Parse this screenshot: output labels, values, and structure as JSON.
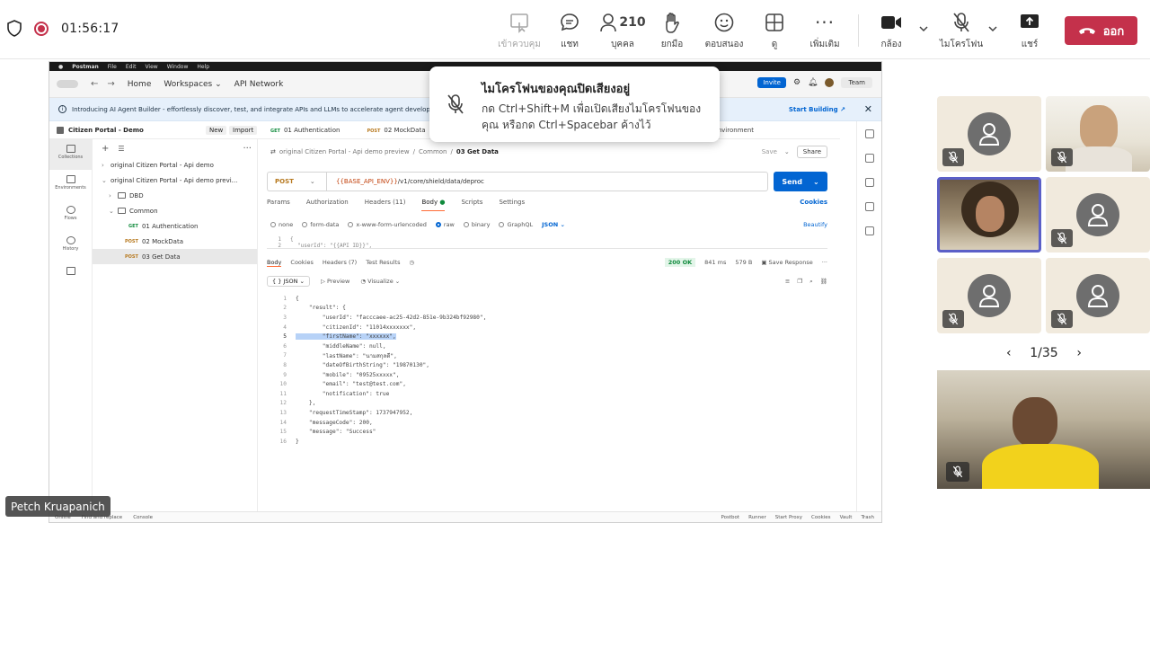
{
  "meeting": {
    "timer": "01:56:17",
    "toolbar": {
      "take_control": "เข้าควบคุม",
      "chat": "แชท",
      "people": "บุคคล",
      "people_count": "210",
      "raise_hand": "ยกมือ",
      "react": "ตอบสนอง",
      "view": "ดู",
      "more": "เพิ่มเติม",
      "camera": "กล้อง",
      "mic": "ไมโครโฟน",
      "share": "แชร์",
      "leave": "ออก"
    },
    "toast": {
      "title": "ไมโครโฟนของคุณปิดเสียงอยู่",
      "body": "กด Ctrl+Shift+M เพื่อเปิดเสียงไมโครโฟนของคุณ หรือกด Ctrl+Spacebar ค้างไว้"
    },
    "gallery": {
      "page": "1/35"
    },
    "presenter_name": "Petch Kruapanich"
  },
  "postman": {
    "menubar": [
      "Postman",
      "File",
      "Edit",
      "View",
      "Window",
      "Help"
    ],
    "header": {
      "home": "Home",
      "workspaces": "Workspaces",
      "api_network": "API Network",
      "invite": "Invite",
      "team": "Team"
    },
    "banner": {
      "text": "Introducing AI Agent Builder - effortlessly discover, test, and integrate APIs and LLMs to accelerate agent developme",
      "cta": "Start Building"
    },
    "workspace": {
      "name": "Citizen Portal - Demo",
      "new": "New",
      "import": "Import"
    },
    "rail": [
      "Collections",
      "Environments",
      "Flows",
      "History"
    ],
    "tree": [
      {
        "label": "original Citizen Portal - Api demo",
        "type": "collection",
        "arrow": "›"
      },
      {
        "label": "original Citizen Portal - Api demo previ...",
        "type": "collection",
        "arrow": "⌄"
      },
      {
        "label": "DBD",
        "type": "folder",
        "arrow": "›"
      },
      {
        "label": "Common",
        "type": "folder",
        "arrow": "⌄"
      },
      {
        "label": "01 Authentication",
        "type": "request",
        "method": "GET"
      },
      {
        "label": "02 MockData",
        "type": "request",
        "method": "POST"
      },
      {
        "label": "03 Get Data",
        "type": "request",
        "method": "POST"
      }
    ],
    "tabs": [
      {
        "method": "GET",
        "label": "01 Authentication"
      },
      {
        "method": "POST",
        "label": "02 MockData"
      }
    ],
    "environment": "No environment",
    "breadcrumb": {
      "collection": "original Citizen Portal - Api demo preview",
      "folder": "Common",
      "request": "03 Get Data",
      "save": "Save",
      "share": "Share"
    },
    "request": {
      "method": "POST",
      "url_var": "{{BASE_API_ENV}}",
      "url_path": " /v1/core/shield/data/deproc",
      "send": "Send",
      "tabs": [
        "Params",
        "Authorization",
        "Headers (11)",
        "Body",
        "Scripts",
        "Settings"
      ],
      "cookies": "Cookies",
      "body_types": [
        "none",
        "form-data",
        "x-www-form-urlencoded",
        "raw",
        "binary",
        "GraphQL"
      ],
      "body_format": "JSON",
      "beautify": "Beautify",
      "body_line1": "{",
      "body_line2": "\"userId\": \"{{API_ID}}\","
    },
    "response": {
      "tabs": [
        "Body",
        "Cookies",
        "Headers (7)",
        "Test Results"
      ],
      "status": "200 OK",
      "time": "841 ms",
      "size": "579 B",
      "save_response": "Save Response",
      "view_json": "JSON",
      "view_preview": "Preview",
      "view_visualize": "Visualize",
      "lines": [
        "{",
        "    \"result\": {",
        "        \"userId\": \"facccaee-ac25-42d2-851e-9b324bf92980\",",
        "        \"citizenId\": \"11014xxxxxxx\",",
        "        \"firstName\": \"xxxxxx\",",
        "        \"middleName\": null,",
        "        \"lastName\": \"นามสกุลดี\",",
        "        \"dateOfBirthString\": \"19870130\",",
        "        \"mobile\": \"09525xxxxx\",",
        "        \"email\": \"test@test.com\",",
        "        \"notification\": true",
        "    },",
        "    \"requestTimeStamp\": 1737947952,",
        "    \"messageCode\": 200,",
        "    \"message\": \"Success\"",
        "}"
      ],
      "highlight_line": 5
    },
    "statusbar": {
      "online": "Online",
      "find_replace": "Find and replace",
      "console": "Console",
      "postbot": "Postbot",
      "runner": "Runner",
      "start_proxy": "Start Proxy",
      "cookies": "Cookies",
      "vault": "Vault",
      "trash": "Trash"
    }
  }
}
